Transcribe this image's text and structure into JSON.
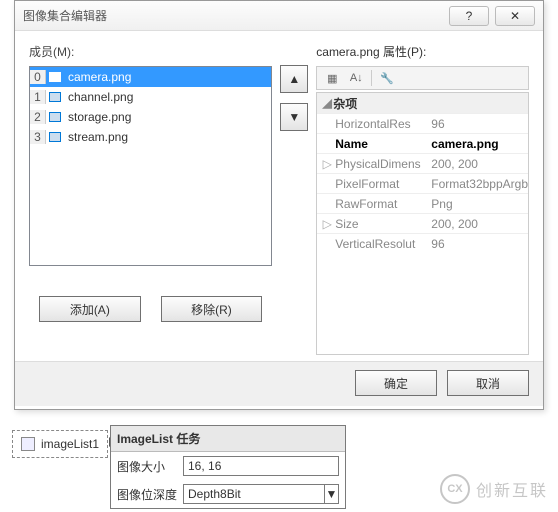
{
  "dialog": {
    "title": "图像集合编辑器",
    "helpGlyph": "?",
    "closeGlyph": "✕",
    "membersLabel": "成员(M):",
    "propsLabelPrefix": "camera.png",
    "propsLabelSuffix": " 属性(P):",
    "list": [
      {
        "idx": "0",
        "name": "camera.png",
        "sel": true
      },
      {
        "idx": "1",
        "name": "channel.png",
        "sel": false
      },
      {
        "idx": "2",
        "name": "storage.png",
        "sel": false
      },
      {
        "idx": "3",
        "name": "stream.png",
        "sel": false
      }
    ],
    "upGlyph": "▲",
    "downGlyph": "▼",
    "addLabel": "添加(A)",
    "removeLabel": "移除(R)",
    "okLabel": "确定",
    "cancelLabel": "取消",
    "category": "杂项",
    "props": [
      {
        "name": "HorizontalResolution",
        "short": "HorizontalRes",
        "value": "96",
        "exp": false,
        "bold": false
      },
      {
        "name": "Name",
        "short": "Name",
        "value": "camera.png",
        "exp": false,
        "bold": true
      },
      {
        "name": "PhysicalDimension",
        "short": "PhysicalDimens",
        "value": "200, 200",
        "exp": true,
        "bold": false
      },
      {
        "name": "PixelFormat",
        "short": "PixelFormat",
        "value": "Format32bppArgb",
        "exp": false,
        "bold": false
      },
      {
        "name": "RawFormat",
        "short": "RawFormat",
        "value": "Png",
        "exp": false,
        "bold": false
      },
      {
        "name": "Size",
        "short": "Size",
        "value": "200, 200",
        "exp": true,
        "bold": false
      },
      {
        "name": "VerticalResolution",
        "short": "VerticalResolut",
        "value": "96",
        "exp": false,
        "bold": false
      }
    ],
    "toolbar": {
      "cat": "▦",
      "sort": "A↓",
      "wrench": "🔧"
    }
  },
  "chip": {
    "label": "imageList1"
  },
  "task": {
    "header": "ImageList 任务",
    "rows": [
      {
        "label": "图像大小",
        "value": "16, 16",
        "dd": false
      },
      {
        "label": "图像位深度",
        "value": "Depth8Bit",
        "dd": true
      }
    ]
  },
  "watermark": {
    "badge": "CX",
    "text": "创新互联"
  }
}
